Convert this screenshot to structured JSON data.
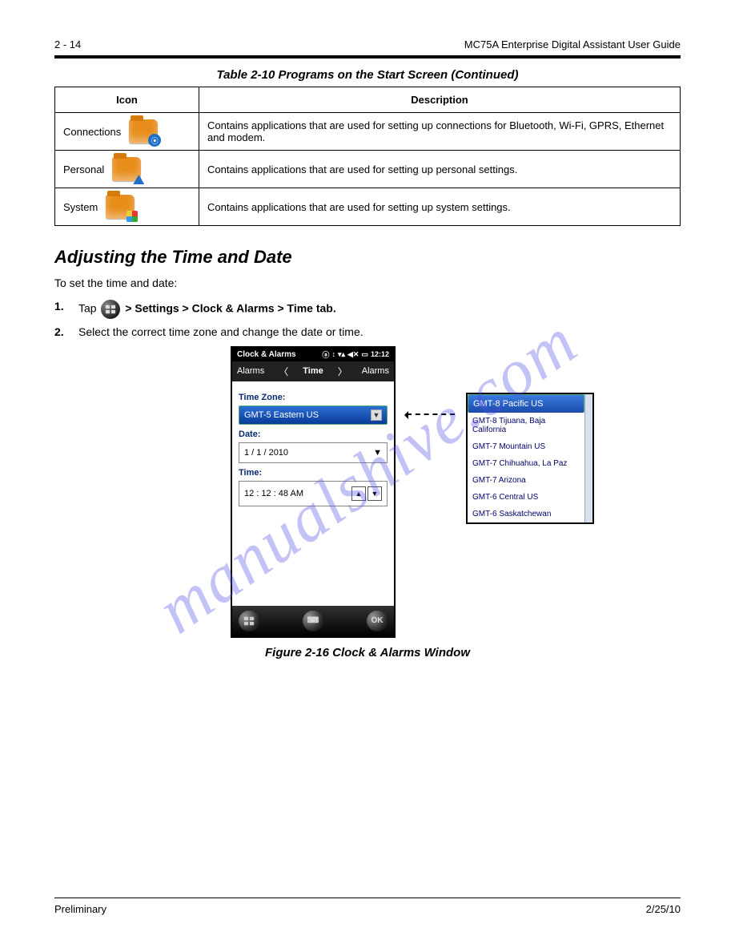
{
  "header": {
    "page_label": "2 - 14",
    "book_title": "MC75A Enterprise Digital Assistant User Guide"
  },
  "table": {
    "caption": "Table 2-10   Programs on the Start Screen (Continued)",
    "col1": "Icon",
    "col2": "Description",
    "rows": [
      {
        "label": "Connections",
        "desc": "Contains applications that are used for setting up connections for Bluetooth, Wi-Fi, GPRS, Ethernet and modem."
      },
      {
        "label": "Personal",
        "desc": "Contains applications that are used for setting up personal settings."
      },
      {
        "label": "System",
        "desc": "Contains applications that are used for setting up system settings."
      }
    ]
  },
  "section": {
    "title": "Adjusting the Time and Date",
    "intro": "To set the time and date:",
    "steps": [
      {
        "n": "1.",
        "pre": "Tap ",
        "after": " > Settings > Clock & Alarms > Time tab."
      },
      {
        "n": "2.",
        "text": "Select the correct time zone and change the date or time."
      }
    ]
  },
  "phone": {
    "title": "Clock & Alarms",
    "clock": "12:12",
    "nav_left": "Alarms",
    "nav_center": "Time",
    "nav_right": "Alarms",
    "tz_label": "Time Zone:",
    "tz_value": "GMT-5 Eastern US",
    "date_label": "Date:",
    "date_value": "1 / 1 / 2010",
    "time_label": "Time:",
    "time_value": "12 : 12 : 48   AM",
    "ok": "OK"
  },
  "tzlist": [
    "GMT-8 Pacific US",
    "GMT-8 Tijuana, Baja California",
    "GMT-7 Mountain US",
    "GMT-7 Chihuahua, La Paz",
    "GMT-7 Arizona",
    "GMT-6 Central US",
    "GMT-6 Saskatchewan"
  ],
  "figure_caption": "Figure 2-16    Clock & Alarms Window",
  "watermark": "manualshive.com",
  "footer": {
    "left": "Preliminary",
    "right": "2/25/10"
  }
}
